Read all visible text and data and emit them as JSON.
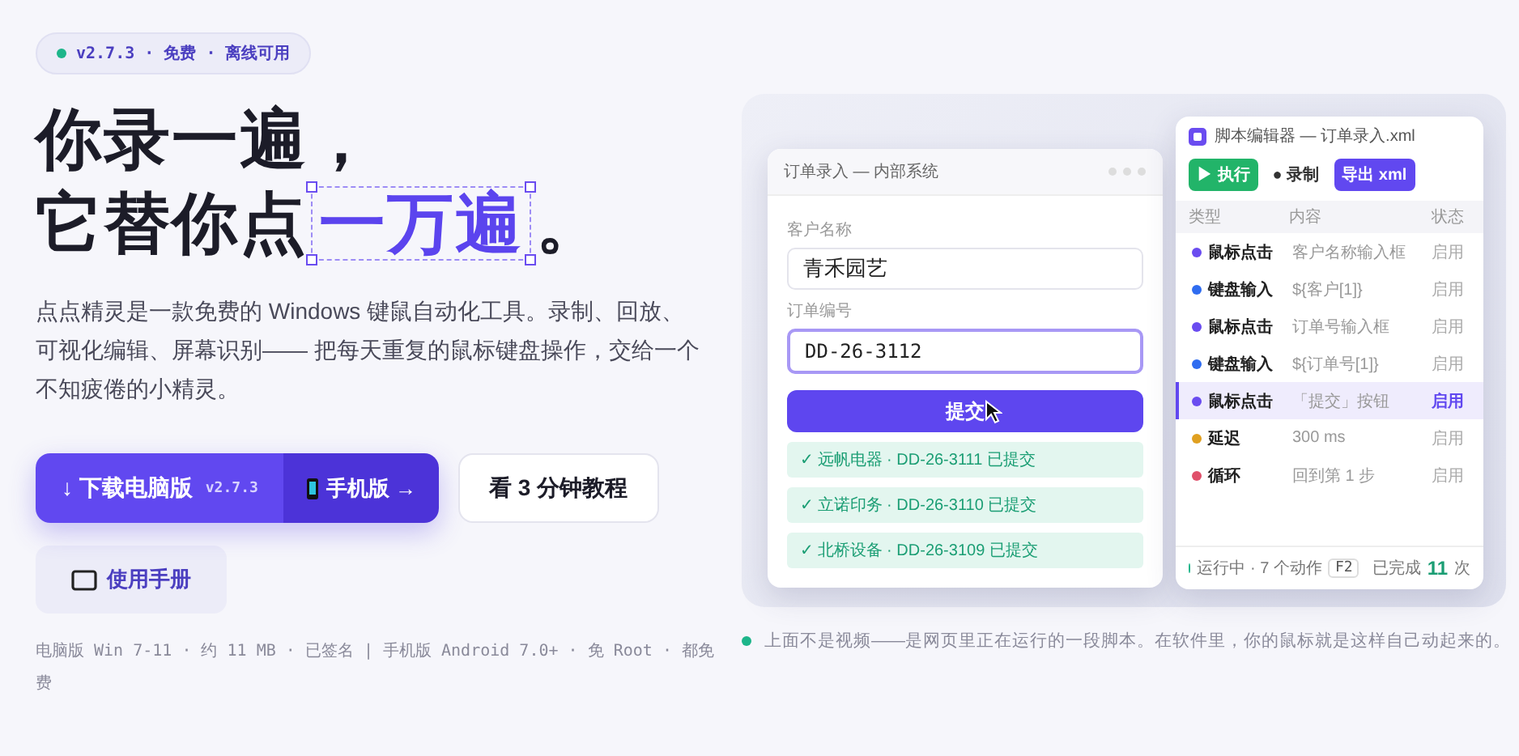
{
  "badge": {
    "text": "v2.7.3 · 免费 · 离线可用"
  },
  "headline": {
    "line1": "你录一遍，",
    "line2": "它替你点",
    "highlight": "一万遍",
    "end": "。"
  },
  "intro": "点点精灵是一款免费的 Windows 键鼠自动化工具。录制、回放、可视化编辑、屏幕识别—— 把每天重复的鼠标键盘操作，交给一个不知疲倦的小精灵。",
  "download": {
    "label": "↓ 下载电脑版",
    "version": "v2.7.3",
    "mobile": "手机版 →"
  },
  "tutorial_button": "看 3 分钟教程",
  "manual_button": "使用手册",
  "footnote": "电脑版 Win 7-11 · 约 11 MB · 已签名 | 手机版 Android 7.0+ · 免 Root · 都免费",
  "form_window": {
    "title": "订单录入 — 内部系统",
    "fields": [
      {
        "label": "客户名称",
        "value": "青禾园艺",
        "focused": false
      },
      {
        "label": "订单编号",
        "value": "DD-26-3112",
        "focused": true
      }
    ],
    "submit": "提交",
    "submitted": [
      "✓ 远帆电器 · DD-26-3111 已提交",
      "✓ 立诺印务 · DD-26-3110 已提交",
      "✓ 北桥设备 · DD-26-3109 已提交"
    ]
  },
  "editor": {
    "title": "脚本编辑器 — 订单录入.xml",
    "toolbar": [
      {
        "kind": "run",
        "label": "▶ 执行"
      },
      {
        "kind": "record",
        "label": "● 录制"
      },
      {
        "kind": "export",
        "label": "导出 xml"
      }
    ],
    "columns": [
      "类型",
      "内容",
      "状态"
    ],
    "rows": [
      {
        "type": "鼠标点击",
        "content": "客户名称输入框",
        "status": "启用",
        "color": "#6a4cf0",
        "selected": false
      },
      {
        "type": "键盘输入",
        "content": "${客户[1]}",
        "status": "启用",
        "color": "#2f6cf0",
        "selected": false
      },
      {
        "type": "鼠标点击",
        "content": "订单号输入框",
        "status": "启用",
        "color": "#6a4cf0",
        "selected": false
      },
      {
        "type": "键盘输入",
        "content": "${订单号[1]}",
        "status": "启用",
        "color": "#2f6cf0",
        "selected": false
      },
      {
        "type": "鼠标点击",
        "content": "「提交」按钮",
        "status": "启用",
        "color": "#6a4cf0",
        "selected": true
      },
      {
        "type": "延迟",
        "content": "300 ms",
        "status": "启用",
        "color": "#e0a020",
        "selected": false
      },
      {
        "type": "循环",
        "content": "回到第 1 步",
        "status": "启用",
        "color": "#e0506a",
        "selected": false
      }
    ],
    "footer": {
      "status": "运行中 · 7 个动作",
      "key": "F2",
      "done_label": "已完成",
      "done_count": "11",
      "done_unit": "次"
    }
  },
  "caption": "上面不是视频——是网页里正在运行的一段脚本。在软件里，你的鼠标就是这样自己动起来的。"
}
